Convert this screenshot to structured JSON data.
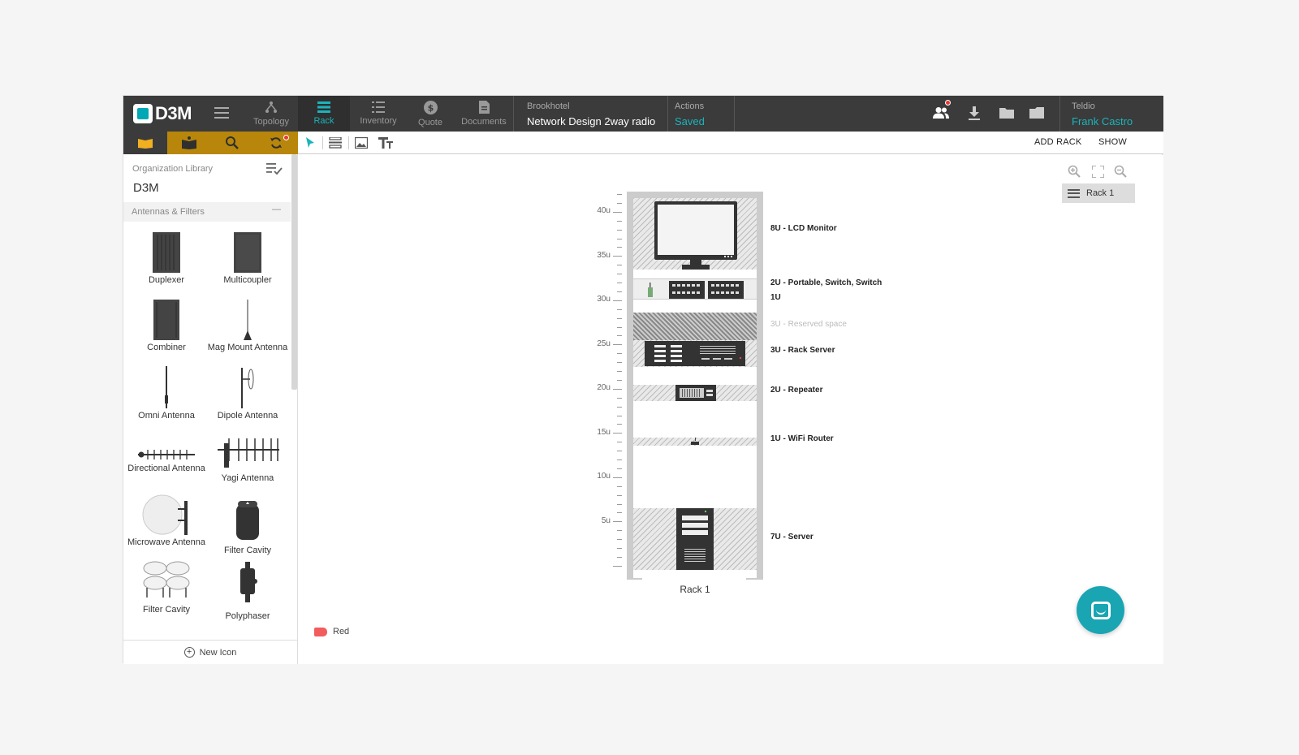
{
  "app": {
    "logo_text": "D3M"
  },
  "nav": {
    "tabs": [
      {
        "label": "Topology",
        "icon": "topology-icon"
      },
      {
        "label": "Rack",
        "icon": "rack-icon"
      },
      {
        "label": "Inventory",
        "icon": "inventory-icon"
      },
      {
        "label": "Quote",
        "icon": "dollar-icon"
      },
      {
        "label": "Documents",
        "icon": "document-icon"
      }
    ]
  },
  "project": {
    "client": "Brookhotel",
    "name": "Network Design 2way radio"
  },
  "actions": {
    "label": "Actions",
    "status": "Saved"
  },
  "user": {
    "org": "Teldio",
    "name": "Frank Castro"
  },
  "library": {
    "org_label": "Organization Library",
    "org_name": "D3M",
    "section": "Antennas & Filters",
    "items": [
      "Duplexer",
      "Multicoupler",
      "Combiner",
      "Mag Mount Antenna",
      "Omni Antenna",
      "Dipole Antenna",
      "Directional Antenna",
      "Yagi Antenna",
      "Microwave Antenna",
      "Filter Cavity",
      "Filter Cavity",
      "Polyphaser"
    ],
    "new_icon": "New Icon"
  },
  "toolbar": {
    "add_rack": "ADD RACK",
    "show": "SHOW"
  },
  "canvas": {
    "rack_chip": "Rack 1",
    "rack_name": "Rack 1",
    "ruler": [
      "40u",
      "35u",
      "30u",
      "25u",
      "20u",
      "15u",
      "10u",
      "5u"
    ],
    "devices": [
      "8U - LCD Monitor",
      "2U - Portable, Switch, Switch",
      "1U",
      "3U - Reserved space",
      "3U - Rack Server",
      "2U - Repeater",
      "1U - WiFi Router",
      "7U - Server"
    ],
    "legend": {
      "label": "Red",
      "color": "#f25c5c"
    }
  },
  "colors": {
    "accent": "#1ab4bc",
    "topbar": "#3b3b3b",
    "library_tab": "#b8860b"
  }
}
